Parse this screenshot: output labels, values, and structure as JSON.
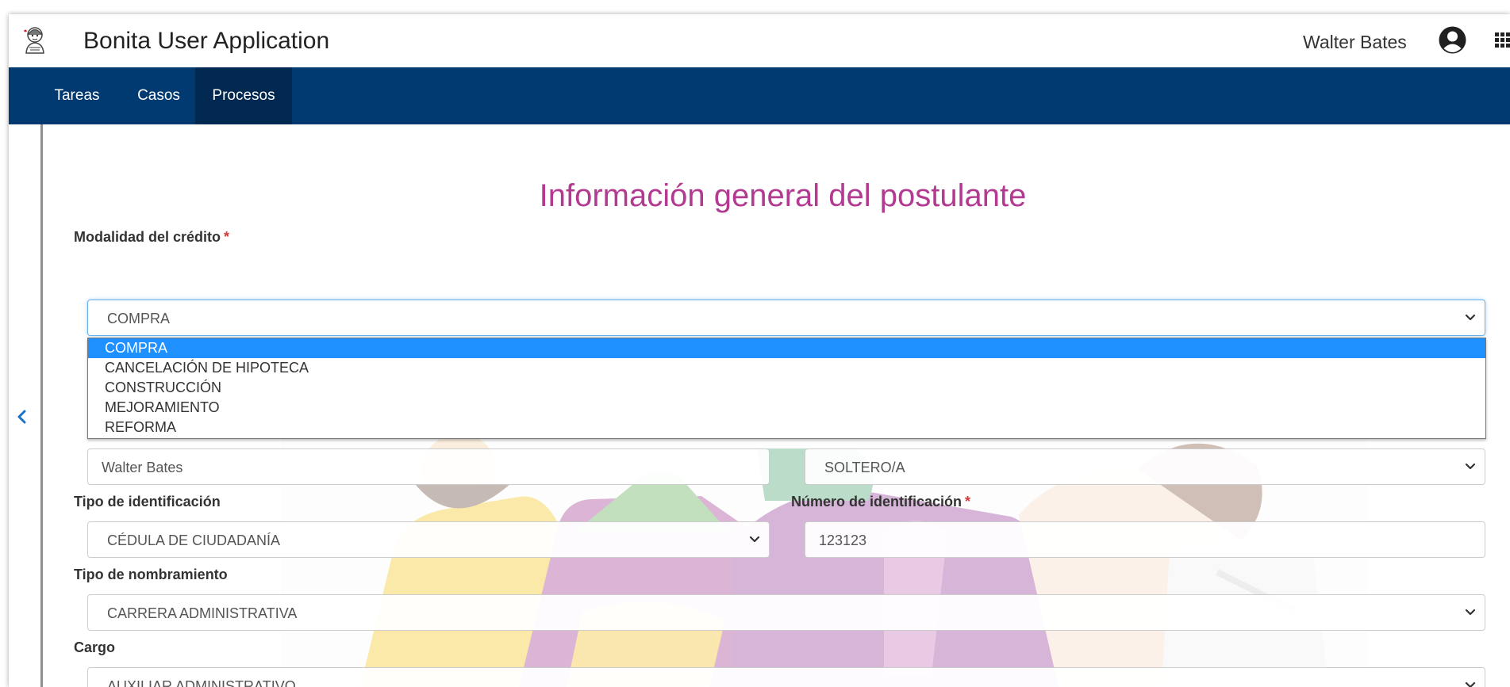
{
  "header": {
    "app_title": "Bonita User Application",
    "user_name": "Walter Bates",
    "logo_icon": "bonita-logo-icon",
    "user_icon": "user-circle-icon",
    "apps_icon": "grid-apps-icon"
  },
  "nav": {
    "tabs": [
      {
        "label": "Tareas",
        "active": false
      },
      {
        "label": "Casos",
        "active": false
      },
      {
        "label": "Procesos",
        "active": true
      }
    ]
  },
  "sidebar": {
    "collapse_icon": "chevron-left-icon"
  },
  "form": {
    "title": "Información general del postulante",
    "modalidad": {
      "label": "Modalidad del crédito",
      "required_mark": "*",
      "value": "COMPRA",
      "options": [
        "COMPRA",
        "CANCELACIÓN DE HIPOTECA",
        "CONSTRUCCIÓN",
        "MEJORAMIENTO",
        "REFORMA"
      ],
      "selected_option": "COMPRA"
    },
    "nombre": {
      "value": "Walter Bates"
    },
    "estado_civil": {
      "value": "SOLTERO/A"
    },
    "tipo_identificacion": {
      "label": "Tipo de identificación",
      "value": "CÉDULA DE CIUDADANÍA"
    },
    "numero_identificacion": {
      "label": "Número de identificación",
      "required_mark": "*",
      "value": "123123"
    },
    "tipo_nombramiento": {
      "label": "Tipo de nombramiento",
      "value": "CARRERA ADMINISTRATIVA"
    },
    "cargo": {
      "label": "Cargo",
      "value": "AUXILIAR ADMINISTRATIVO"
    }
  },
  "colors": {
    "navbar": "#003a70",
    "navbar_active": "#002850",
    "title": "#b23a90",
    "selected_option": "#1e90ff",
    "required": "#d23b3b"
  }
}
